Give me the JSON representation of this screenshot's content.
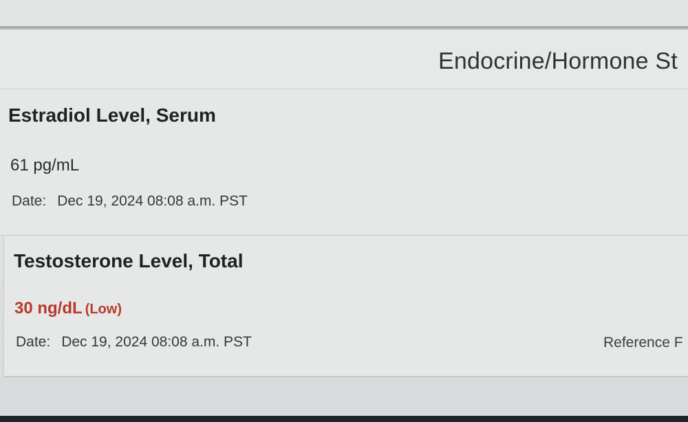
{
  "section": {
    "title": "Endocrine/Hormone St"
  },
  "results": [
    {
      "name": "Estradiol Level, Serum",
      "value": "61 pg/mL",
      "date_label": "Date:",
      "date": "Dec 19, 2024 08:08 a.m. PST"
    },
    {
      "name": "Testosterone Level, Total",
      "value": "30 ng/dL",
      "flag": "(Low)",
      "date_label": "Date:",
      "date": "Dec 19, 2024 08:08 a.m. PST",
      "reference_label": "Reference F"
    }
  ],
  "colors": {
    "abnormal_value": "#b8392a",
    "text_primary": "#1f2224",
    "background": "#e6e8e7"
  }
}
